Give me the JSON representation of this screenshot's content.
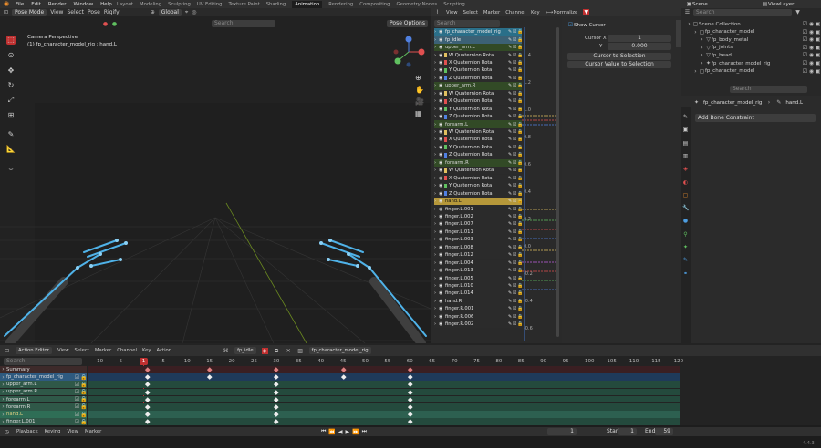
{
  "topbar": {
    "menus": [
      "File",
      "Edit",
      "Render",
      "Window",
      "Help"
    ],
    "workspaces": [
      "Layout",
      "Modeling",
      "Sculpting",
      "UV Editing",
      "Texture Paint",
      "Shading",
      "Animation",
      "Rendering",
      "Compositing",
      "Geometry Nodes",
      "Scripting"
    ],
    "active_workspace": "Animation",
    "scene": "Scene",
    "view_layer": "ViewLayer"
  },
  "viewport": {
    "mode": "Pose Mode",
    "menus": [
      "View",
      "Select",
      "Pose",
      "Rigify"
    ],
    "transform": "Global",
    "search_placeholder": "Search",
    "pose_options": "Pose Options",
    "info_line1": "Camera Perspective",
    "info_line2": "(1) fp_character_model_rig : hand.L"
  },
  "graph": {
    "menus": [
      "View",
      "Select",
      "Marker",
      "Channel",
      "Key"
    ],
    "normalize": "Normalize",
    "search_placeholder": "Search",
    "channels": [
      {
        "t": "grp",
        "label": "fp_character_model_rig"
      },
      {
        "t": "grp2",
        "label": "fp_idle"
      },
      {
        "t": "sub",
        "label": "upper_arm.L"
      },
      {
        "t": "ch",
        "label": "W Quaternion Rota",
        "c": "#e0c060"
      },
      {
        "t": "ch",
        "label": "X Quaternion Rota",
        "c": "#e05050"
      },
      {
        "t": "ch",
        "label": "Y Quaternion Rota",
        "c": "#60c060"
      },
      {
        "t": "ch",
        "label": "Z Quaternion Rota",
        "c": "#5080e0"
      },
      {
        "t": "sub",
        "label": "upper_arm.R"
      },
      {
        "t": "ch",
        "label": "W Quaternion Rota",
        "c": "#e0c060"
      },
      {
        "t": "ch",
        "label": "X Quaternion Rota",
        "c": "#e05050"
      },
      {
        "t": "ch",
        "label": "Y Quaternion Rota",
        "c": "#60c060"
      },
      {
        "t": "ch",
        "label": "Z Quaternion Rota",
        "c": "#5080e0"
      },
      {
        "t": "sub",
        "label": "forearm.L"
      },
      {
        "t": "ch",
        "label": "W Quaternion Rota",
        "c": "#e0c060"
      },
      {
        "t": "ch",
        "label": "X Quaternion Rota",
        "c": "#e05050"
      },
      {
        "t": "ch",
        "label": "Y Quaternion Rota",
        "c": "#60c060"
      },
      {
        "t": "ch",
        "label": "Z Quaternion Rota",
        "c": "#5080e0"
      },
      {
        "t": "sub",
        "label": "forearm.R"
      },
      {
        "t": "ch",
        "label": "W Quaternion Rota",
        "c": "#e0c060"
      },
      {
        "t": "ch",
        "label": "X Quaternion Rota",
        "c": "#e05050"
      },
      {
        "t": "ch",
        "label": "Y Quaternion Rota",
        "c": "#60c060"
      },
      {
        "t": "ch",
        "label": "Z Quaternion Rota",
        "c": "#5080e0"
      },
      {
        "t": "sel",
        "label": "hand.L"
      },
      {
        "t": "bone",
        "label": "finger.L.001"
      },
      {
        "t": "bone",
        "label": "finger.L.002"
      },
      {
        "t": "bone",
        "label": "finger.L.007"
      },
      {
        "t": "bone",
        "label": "finger.L.011"
      },
      {
        "t": "bone",
        "label": "finger.L.003"
      },
      {
        "t": "bone",
        "label": "finger.L.008"
      },
      {
        "t": "bone",
        "label": "finger.L.012"
      },
      {
        "t": "bone",
        "label": "finger.L.004"
      },
      {
        "t": "bone",
        "label": "finger.L.013"
      },
      {
        "t": "bone",
        "label": "finger.L.005"
      },
      {
        "t": "bone",
        "label": "finger.L.010"
      },
      {
        "t": "bone",
        "label": "finger.L.014"
      },
      {
        "t": "bone",
        "label": "hand.R"
      },
      {
        "t": "bone",
        "label": "finger.R.001"
      },
      {
        "t": "bone",
        "label": "finger.R.006"
      },
      {
        "t": "bone",
        "label": "finger.R.002"
      }
    ],
    "y_labels": [
      "1.4",
      "1.2",
      "1.0",
      "0.8",
      "0.6",
      "0.4",
      "0.2",
      "0.0",
      "-0.2",
      "-0.4",
      "-0.6"
    ]
  },
  "sidebar": {
    "show_cursor": "Show Cursor",
    "cursor_x_label": "Cursor X",
    "cursor_x": "1",
    "y_label": "Y",
    "y_value": "0.000",
    "btn1": "Cursor to Selection",
    "btn2": "Cursor Value to Selection"
  },
  "outliner": {
    "search_placeholder": "Search",
    "items": [
      {
        "label": "Scene Collection",
        "indent": 0
      },
      {
        "label": "fp_character_model",
        "indent": 1
      },
      {
        "label": "fp_body_metal",
        "indent": 2
      },
      {
        "label": "fp_joints",
        "indent": 2
      },
      {
        "label": "fp_head",
        "indent": 2
      },
      {
        "label": "fp_character_model_rig",
        "indent": 2
      },
      {
        "label": "fp_character_model",
        "indent": 1
      }
    ]
  },
  "properties": {
    "object": "fp_character_model_rig",
    "bone": "hand.L",
    "add_constraint": "Add Bone Constraint"
  },
  "action_editor": {
    "mode": "Action Editor",
    "menus": [
      "View",
      "Select",
      "Marker",
      "Channel",
      "Key",
      "Action"
    ],
    "action": "fp_idle",
    "object": "fp_character_model_rig",
    "search_placeholder": "Search",
    "frames": [
      "-10",
      "-5",
      "0",
      "5",
      "10",
      "15",
      "20",
      "25",
      "30",
      "35",
      "40",
      "45",
      "50",
      "55",
      "60",
      "65",
      "70",
      "75",
      "80",
      "85",
      "90",
      "95",
      "100",
      "105",
      "110",
      "115",
      "120"
    ],
    "current_frame": "1",
    "rows": [
      {
        "label": "Summary",
        "t": "sum"
      },
      {
        "label": "fp_character_model_rig",
        "t": "obj"
      },
      {
        "label": "upper_arm.L",
        "t": "g"
      },
      {
        "label": "upper_arm.R",
        "t": "g"
      },
      {
        "label": "forearm.L",
        "t": "g"
      },
      {
        "label": "forearm.R",
        "t": "g"
      },
      {
        "label": "hand.L",
        "t": "gsel"
      },
      {
        "label": "finger.L.001",
        "t": "g"
      }
    ]
  },
  "timeline": {
    "menus": [
      "Playback",
      "Keying",
      "View",
      "Marker"
    ],
    "current": "1",
    "start_label": "Start",
    "start": "1",
    "end_label": "End",
    "end": "59",
    "version": "4.4.3"
  }
}
